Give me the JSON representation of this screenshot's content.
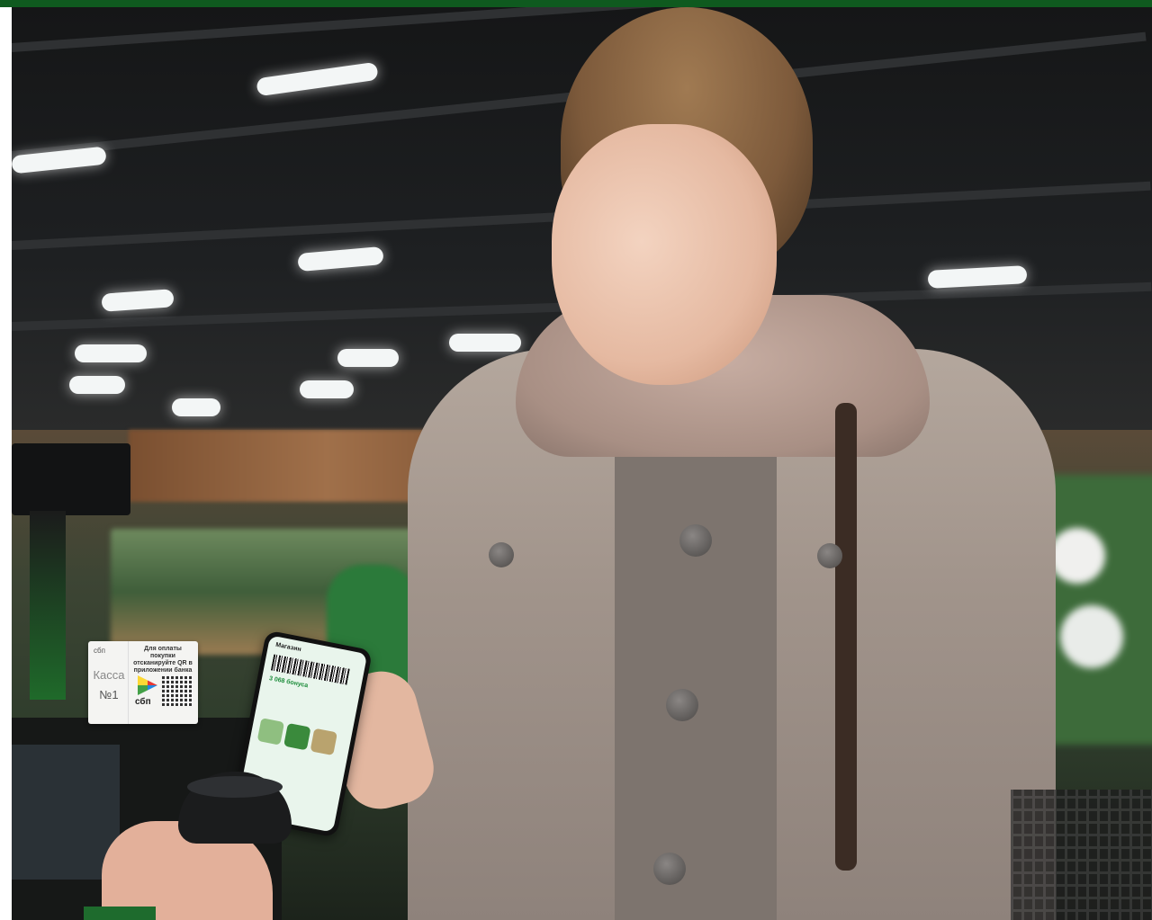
{
  "photo": {
    "kassa_box": {
      "logo_text": "сбп",
      "kassa_label": "Касса",
      "kassa_number": "№1",
      "instruction": "Для оплаты покупки отсканируйте QR в приложении банка",
      "sbp_label": "сбп"
    },
    "phone_screen": {
      "title": "Магазин",
      "bonus": "3 068 бонуса"
    }
  },
  "colors": {
    "brand_green": "#0f5a1f"
  }
}
